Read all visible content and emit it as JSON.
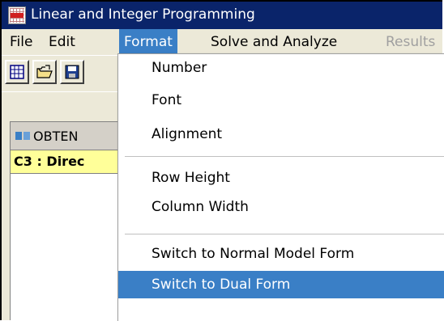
{
  "window": {
    "title": "Linear and Integer Programming",
    "app_icon": "lip-grid-icon"
  },
  "menubar": {
    "items": [
      {
        "label": "File"
      },
      {
        "label": "Edit"
      },
      {
        "label": "Format"
      },
      {
        "label": "Solve and Analyze"
      },
      {
        "label": "Results"
      }
    ],
    "active": "Format",
    "disabled": [
      "Results"
    ]
  },
  "toolbar": {
    "buttons": [
      "grid-icon",
      "open-folder-icon",
      "save-icon"
    ]
  },
  "child_window": {
    "title": "OBTEN",
    "cell_ref": "C3 : Direc"
  },
  "format_menu": {
    "items": [
      {
        "label": "Number"
      },
      {
        "label": "Font"
      },
      {
        "label": "Alignment"
      },
      {
        "label": "Row Height"
      },
      {
        "label": "Column Width"
      },
      {
        "label": "Switch to Normal Model Form"
      },
      {
        "label": "Switch to Dual Form"
      }
    ],
    "highlighted": "Switch to Dual Form"
  },
  "colors": {
    "title_bg": "#0a246a",
    "menu_highlight": "#3a7fc6",
    "face": "#ece9d8",
    "cell_ref_bg": "#ffff99"
  }
}
